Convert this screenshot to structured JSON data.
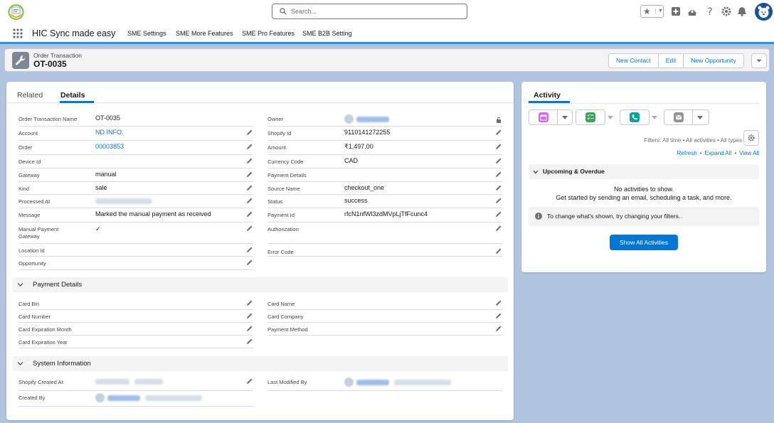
{
  "header": {
    "search_placeholder": "Search..."
  },
  "nav": {
    "app_name": "HIC Sync made easy",
    "items": [
      "SME Settings",
      "SME More Features",
      "SME Pro Features",
      "SME B2B Setting"
    ]
  },
  "record": {
    "object_label": "Order Transaction",
    "title": "OT-0035",
    "actions": [
      "New Contact",
      "Edit",
      "New Opportunity"
    ]
  },
  "tabs": [
    "Related",
    "Details"
  ],
  "left_fields": [
    {
      "label": "Order Transaction Name",
      "value": "OT-0035"
    },
    {
      "label": "Account",
      "value": "ND INFO."
    },
    {
      "label": "Order",
      "value": "00003853"
    },
    {
      "label": "Device Id",
      "value": ""
    },
    {
      "label": "Gateway",
      "value": "manual"
    },
    {
      "label": "Kind",
      "value": "sale"
    },
    {
      "label": "Processed At",
      "value": ""
    },
    {
      "label": "Message",
      "value": "Marked the manual payment as received"
    },
    {
      "label": "Manual Payment Gateway",
      "value": "✓"
    },
    {
      "label": "Location Id",
      "value": ""
    },
    {
      "label": "Opportunity",
      "value": ""
    }
  ],
  "right_fields": [
    {
      "label": "Owner",
      "value": ""
    },
    {
      "label": "Shopify Id",
      "value": "9110141272255"
    },
    {
      "label": "Amount",
      "value": "₹1,497.00"
    },
    {
      "label": "Currency Code",
      "value": "CAD"
    },
    {
      "label": "Payment Details",
      "value": ""
    },
    {
      "label": "Source Name",
      "value": "checkout_one"
    },
    {
      "label": "Status",
      "value": "success"
    },
    {
      "label": "Payment Id",
      "value": "rfcN1nfWl3zdMVpLjTfFcunc4"
    },
    {
      "label": "Authorization",
      "value": ""
    },
    {
      "label": "Error Code",
      "value": ""
    }
  ],
  "payment_section": {
    "title": "Payment Details",
    "left": [
      "Card Bin",
      "Card Number",
      "Card Expiration Month",
      "Card Expiration Year"
    ],
    "right": [
      "Card Name",
      "Card Company",
      "Payment Method"
    ]
  },
  "system_section": {
    "title": "System Information",
    "left": [
      "Shopify Created At",
      "Created By"
    ],
    "right": [
      "Last Modified By"
    ]
  },
  "activity": {
    "tab": "Activity",
    "filters_text": "Filters: All time • All activities • All types",
    "links": [
      "Refresh",
      "Expand All",
      "View All"
    ],
    "upcoming_title": "Upcoming & Overdue",
    "no_activity": "No activities to show.",
    "get_started": "Get started by sending an email, scheduling a task, and more.",
    "filter_hint": "To change what's shown, try changing your filters.",
    "show_all_label": "Show All Activities"
  },
  "colors": {
    "brand": "#0176d3",
    "background": "#b0c4df",
    "event_icon": "#cb65ff",
    "task_icon": "#3ba755",
    "call_icon": "#06a59a",
    "email_icon": "#939393"
  }
}
